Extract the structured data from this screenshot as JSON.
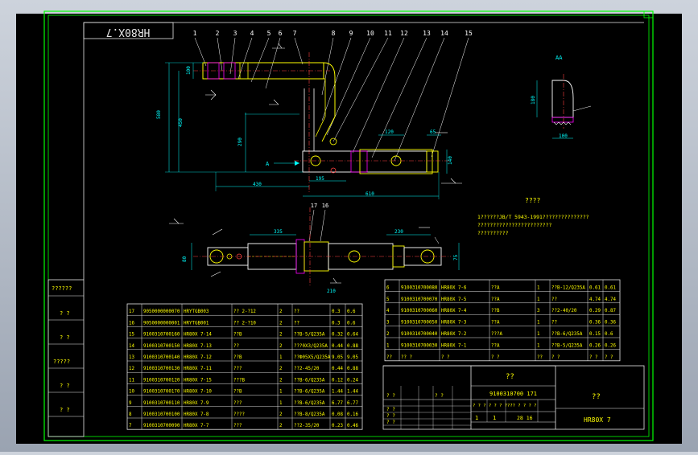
{
  "title_tab": "HR80X.7",
  "balloons": [
    "1",
    "2",
    "3",
    "4",
    "5",
    "6",
    "7",
    "8",
    "9",
    "10",
    "11",
    "12",
    "13",
    "14",
    "15"
  ],
  "balloons2": [
    "17",
    "16"
  ],
  "view_label": "AA",
  "arrow_label": "A",
  "dims": {
    "d580": "580",
    "d450": "450",
    "d290": "290",
    "d430": "430",
    "d195": "195",
    "d610": "610",
    "d120": "120",
    "d140": "140",
    "d100": "100",
    "d65": "65",
    "d180": "180",
    "d75": "75",
    "d120b": "120",
    "d80": "80",
    "d335": "335",
    "d230": "230",
    "d100b": "100",
    "d210": "210"
  },
  "notes": {
    "title": "????",
    "line1": "1??????JB/T 5943-1991???????????????",
    "line2": "????????????????????????",
    "line3": "??????????"
  },
  "left_strip": [
    "??????",
    "? ?",
    "? ?",
    "?????",
    "? ?",
    "? ?"
  ],
  "bom_left": [
    [
      "17",
      "9050000000070",
      "HRYTGB003",
      "?? 2-?12",
      "2",
      "??",
      "0.3",
      "0.6"
    ],
    [
      "16",
      "9050000000001",
      "HRYTGB001",
      "?? 2-?10",
      "2",
      "??",
      "0.3",
      "0.6"
    ],
    [
      "15",
      "9100310700160",
      "HR80X 7-14",
      "??B",
      "2",
      "??B-5/Q235A",
      "0.32",
      "0.64"
    ],
    [
      "14",
      "9100310700150",
      "HR80X 7-13",
      "??",
      "2",
      "???0X3/Q235A",
      "0.44",
      "0.88"
    ],
    [
      "13",
      "9100310700140",
      "HR80X 7-12",
      "??B",
      "1",
      "??Ф05X5/Q235A",
      "9.05",
      "9.05"
    ],
    [
      "12",
      "9100310700130",
      "HR80X 7-11",
      "???",
      "2",
      "??2-45/20",
      "0.44",
      "0.88"
    ],
    [
      "11",
      "9100310700120",
      "HR80X 7-15",
      "???B",
      "2",
      "??B-6/Q235A",
      "0.12",
      "0.24"
    ],
    [
      "10",
      "9100310700170",
      "HR80X 7-10",
      "??B",
      "1",
      "??B-6/Q235A",
      "1.44",
      "1.44"
    ],
    [
      "9",
      "9100310700110",
      "HR80X 7-9",
      "???",
      "1",
      "??B-6/Q235A",
      "6.77",
      "6.77"
    ],
    [
      "8",
      "9100310700100",
      "HR80X 7-8",
      "????",
      "2",
      "??B-8/Q235A",
      "0.08",
      "0.16"
    ],
    [
      "7",
      "9100310700090",
      "HR80X 7-7",
      "???",
      "2",
      "??2-35/20",
      "0.23",
      "0.46"
    ]
  ],
  "bom_right": [
    [
      "6",
      "9100310700080",
      "HR80X 7-6",
      "??A",
      "1",
      "??B-12/Q235A",
      "0.61",
      "0.61"
    ],
    [
      "5",
      "9100310700070",
      "HR80X 7-5",
      "??A",
      "1",
      "??",
      "4.74",
      "4.74"
    ],
    [
      "4",
      "9100310700060",
      "HR80X 7-4",
      "??B",
      "3",
      "??2-40/20",
      "0.29",
      "0.87"
    ],
    [
      "3",
      "9100310700050",
      "HR80X 7-3",
      "??A",
      "1",
      "??",
      "0.36",
      "0.36"
    ],
    [
      "2",
      "9100310700040",
      "HR80X 7-2",
      "???A",
      "1",
      "??B-6/Q235A",
      "0.15",
      "0.6"
    ],
    [
      "1",
      "9100310700030",
      "HR80X 7-1",
      "??A",
      "1",
      "??B-5/Q235A",
      "0.26",
      "0.26"
    ]
  ],
  "bom_header": [
    "??",
    "?? ?",
    "? ?",
    "? ?",
    "??",
    "? ?",
    "? ?",
    "? ?"
  ],
  "title_block": {
    "name": "??",
    "code": "9100310700 171",
    "right_top": "??",
    "drawing_no": "HR80X 7",
    "scale": "1",
    "sheet": "1",
    "weight": "28 16",
    "row_a": [
      "? ?",
      "? ?",
      "? ?",
      "? ?",
      "? ?"
    ],
    "marks": "? ?  ? ?  ? ?  ????  ? ?  ? ?"
  }
}
